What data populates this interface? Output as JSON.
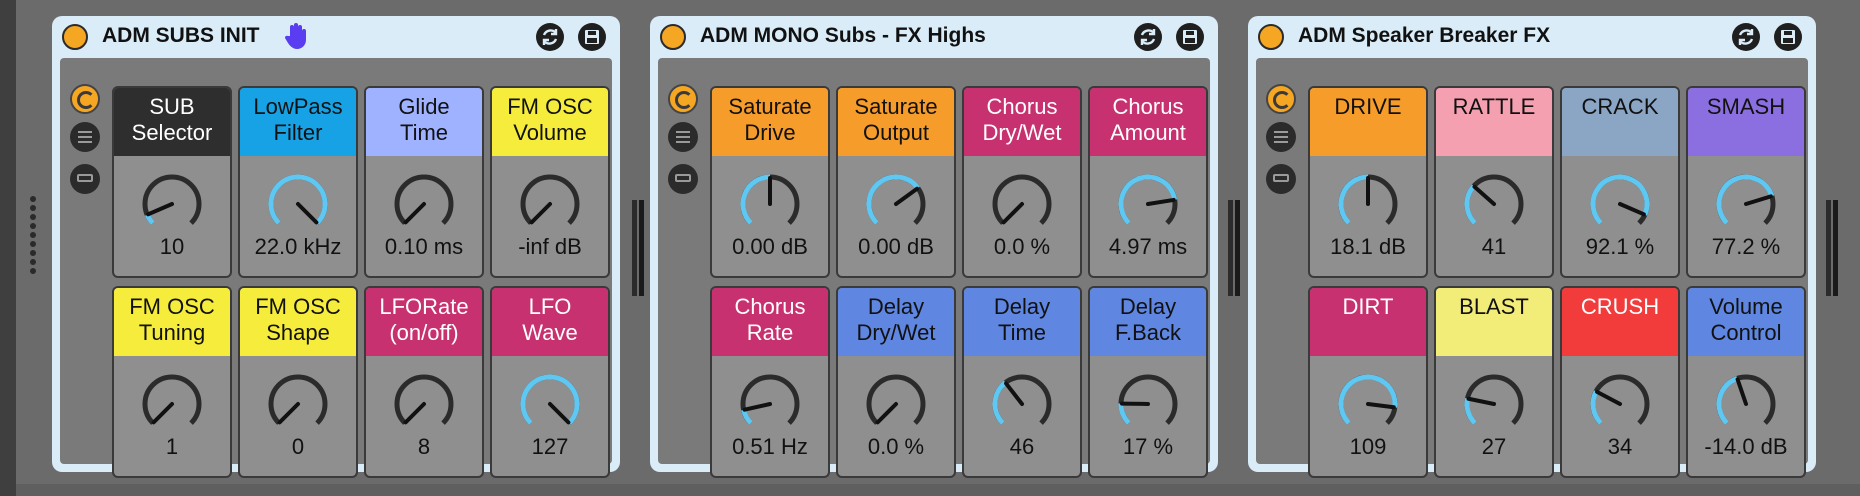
{
  "racks": [
    {
      "title": "ADM SUBS INIT",
      "has_hand_icon": true,
      "macros": [
        {
          "label": "SUB\nSelector",
          "value": "10",
          "color": "#2e2e2e",
          "text": "#ffffff",
          "level": 0.08
        },
        {
          "label": "LowPass\nFilter",
          "value": "22.0 kHz",
          "color": "#16a2e4",
          "text": "#111111",
          "level": 1.0
        },
        {
          "label": "Glide\nTime",
          "value": "0.10 ms",
          "color": "#9fb2ff",
          "text": "#111111",
          "level": 0.0
        },
        {
          "label": "FM OSC\nVolume",
          "value": "-inf dB",
          "color": "#f5ec3b",
          "text": "#111111",
          "level": 0.0
        },
        {
          "label": "FM OSC\nTuning",
          "value": "1",
          "color": "#f5ec3b",
          "text": "#111111",
          "level": 0.0
        },
        {
          "label": "FM OSC\nShape",
          "value": "0",
          "color": "#f5ec3b",
          "text": "#111111",
          "level": 0.0
        },
        {
          "label": "LFORate\n(on/off)",
          "value": "8",
          "color": "#c8316f",
          "text": "#ffffff",
          "level": 0.0
        },
        {
          "label": "LFO\nWave",
          "value": "127",
          "color": "#c8316f",
          "text": "#ffffff",
          "level": 1.0
        }
      ]
    },
    {
      "title": "ADM MONO Subs - FX Highs",
      "has_hand_icon": false,
      "macros": [
        {
          "label": "Saturate\nDrive",
          "value": "0.00 dB",
          "color": "#f59c2a",
          "text": "#111111",
          "level": 0.5
        },
        {
          "label": "Saturate\nOutput",
          "value": "0.00 dB",
          "color": "#f59c2a",
          "text": "#111111",
          "level": 0.7
        },
        {
          "label": "Chorus\nDry/Wet",
          "value": "0.0 %",
          "color": "#c8316f",
          "text": "#ffffff",
          "level": 0.0
        },
        {
          "label": "Chorus\nAmount",
          "value": "4.97 ms",
          "color": "#c8316f",
          "text": "#ffffff",
          "level": 0.8
        },
        {
          "label": "Chorus\nRate",
          "value": "0.51 Hz",
          "color": "#c8316f",
          "text": "#ffffff",
          "level": 0.12
        },
        {
          "label": "Delay\nDry/Wet",
          "value": "0.0 %",
          "color": "#5f86e0",
          "text": "#111111",
          "level": 0.0
        },
        {
          "label": "Delay\nTime",
          "value": "46",
          "color": "#5f86e0",
          "text": "#111111",
          "level": 0.36
        },
        {
          "label": "Delay\nF.Back",
          "value": "17 %",
          "color": "#5f86e0",
          "text": "#111111",
          "level": 0.17
        }
      ]
    },
    {
      "title": "ADM Speaker Breaker FX",
      "has_hand_icon": false,
      "macros": [
        {
          "label": "DRIVE",
          "value": "18.1 dB",
          "color": "#f59c2a",
          "text": "#111111",
          "level": 0.5
        },
        {
          "label": "RATTLE",
          "value": "41",
          "color": "#f5a0b0",
          "text": "#111111",
          "level": 0.32
        },
        {
          "label": "CRACK",
          "value": "92.1 %",
          "color": "#8aa6c4",
          "text": "#111111",
          "level": 0.92
        },
        {
          "label": "SMASH",
          "value": "77.2 %",
          "color": "#8b6fe0",
          "text": "#111111",
          "level": 0.77
        },
        {
          "label": "DIRT",
          "value": "109",
          "color": "#c8316f",
          "text": "#ffffff",
          "level": 0.86
        },
        {
          "label": "BLAST",
          "value": "27",
          "color": "#f2ec78",
          "text": "#111111",
          "level": 0.21
        },
        {
          "label": "CRUSH",
          "value": "34",
          "color": "#f23b3b",
          "text": "#ffffff",
          "level": 0.27
        },
        {
          "label": "Volume\nControl",
          "value": "-14.0 dB",
          "color": "#5f86e0",
          "text": "#111111",
          "level": 0.43
        }
      ]
    }
  ],
  "colors": {
    "knob_arc": "#5ec7f2",
    "knob_track": "#2b2b2b",
    "panel_bg": "#d9ecf7"
  },
  "icons": {
    "power": "power-icon",
    "hotswap": "hotswap-icon",
    "save": "save-icon",
    "map": "map-icon",
    "list": "list-icon",
    "rand": "randomize-icon"
  }
}
